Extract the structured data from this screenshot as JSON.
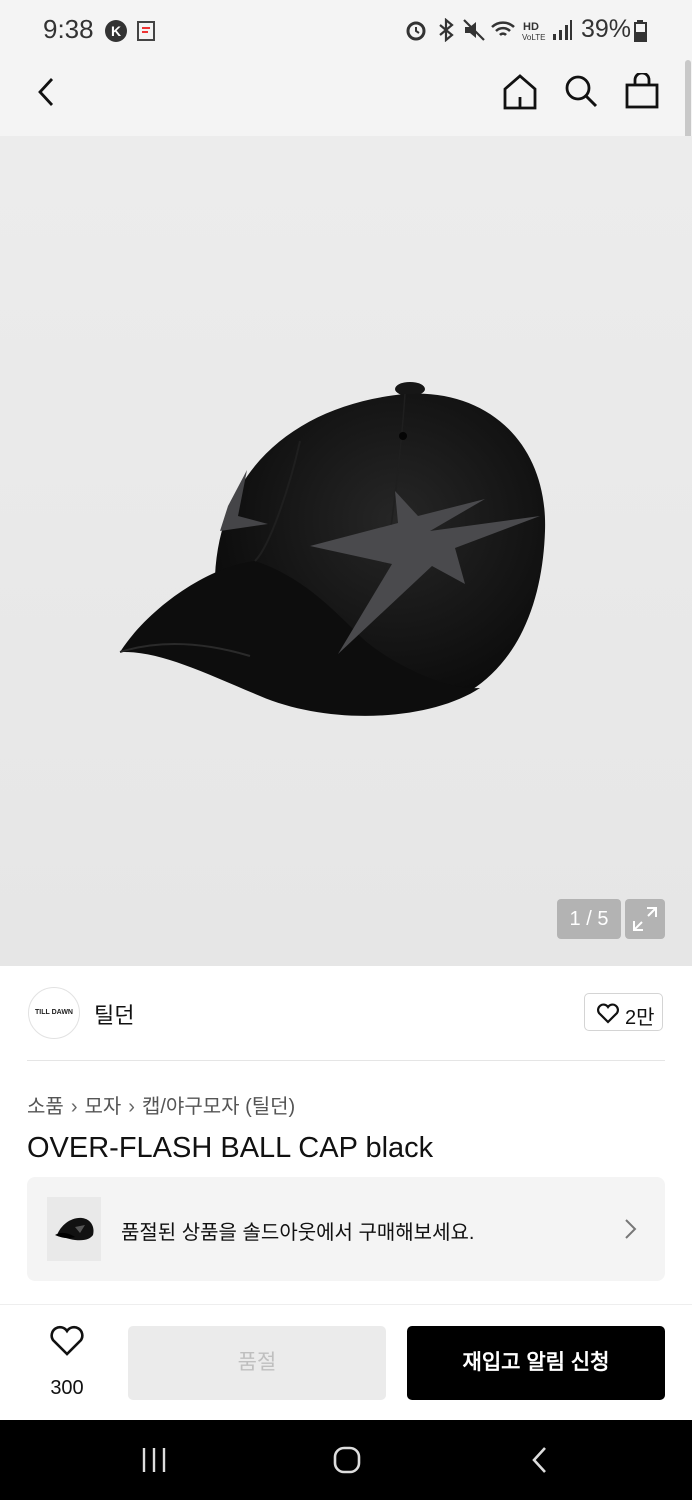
{
  "status_bar": {
    "time": "9:38",
    "battery": "39%"
  },
  "product": {
    "image_counter": "1 / 5",
    "brand": {
      "logo_text": "TILL DAWN",
      "name": "틸던",
      "likes": "2만"
    },
    "breadcrumb": [
      "소품",
      "모자",
      "캡/야구모자 (틸던)"
    ],
    "title": "OVER-FLASH BALL CAP black",
    "soldout_banner": "품절된 상품을 솔드아웃에서 구매해보세요."
  },
  "bottom_bar": {
    "wish_count": "300",
    "soldout_label": "품절",
    "restock_label": "재입고 알림 신청"
  },
  "colors": {
    "primary": "#000000",
    "soldout_bg": "#ebebeb"
  },
  "icons": [
    "back-arrow-icon",
    "home-icon",
    "search-icon",
    "shopping-bag-icon",
    "expand-icon",
    "heart-icon",
    "chevron-right-icon"
  ]
}
